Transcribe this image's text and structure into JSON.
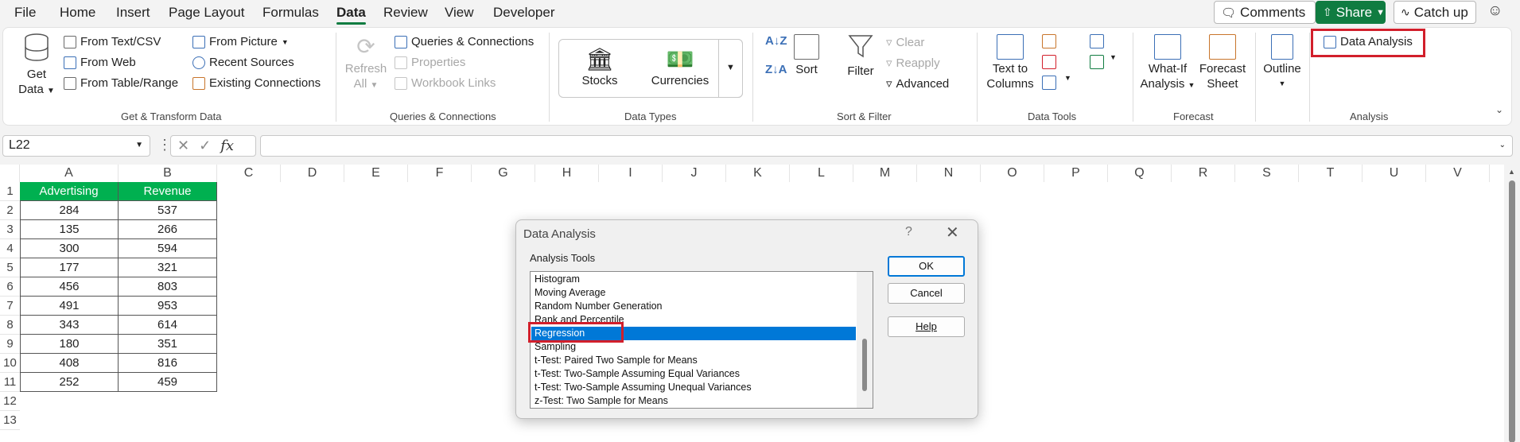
{
  "menu": {
    "tabs": [
      {
        "label": "File"
      },
      {
        "label": "Home"
      },
      {
        "label": "Insert"
      },
      {
        "label": "Page Layout"
      },
      {
        "label": "Formulas"
      },
      {
        "label": "Data"
      },
      {
        "label": "Review"
      },
      {
        "label": "View"
      },
      {
        "label": "Developer"
      }
    ],
    "active_tab": "Data",
    "comments_label": "Comments",
    "share_label": "Share",
    "catchup_label": "Catch up"
  },
  "ribbon": {
    "get_data": {
      "line1": "Get",
      "line2": "Data"
    },
    "from_text_csv": "From Text/CSV",
    "from_web": "From Web",
    "from_table_range": "From Table/Range",
    "from_picture": "From Picture",
    "recent_sources": "Recent Sources",
    "existing_connections": "Existing Connections",
    "group_get_transform": "Get & Transform Data",
    "refresh_all": {
      "line1": "Refresh",
      "line2": "All"
    },
    "queries_connections": "Queries & Connections",
    "properties": "Properties",
    "workbook_links": "Workbook Links",
    "group_queries": "Queries & Connections",
    "stocks": "Stocks",
    "currencies": "Currencies",
    "group_data_types": "Data Types",
    "sort": "Sort",
    "filter": "Filter",
    "clear": "Clear",
    "reapply": "Reapply",
    "advanced": "Advanced",
    "group_sort_filter": "Sort & Filter",
    "text_to_columns": {
      "line1": "Text to",
      "line2": "Columns"
    },
    "group_data_tools": "Data Tools",
    "what_if": {
      "line1": "What-If",
      "line2": "Analysis"
    },
    "forecast_sheet": {
      "line1": "Forecast",
      "line2": "Sheet"
    },
    "group_forecast": "Forecast",
    "outline": "Outline",
    "data_analysis": "Data Analysis",
    "group_analysis": "Analysis"
  },
  "formula_bar": {
    "name_box": "L22",
    "fx": "fx",
    "formula": ""
  },
  "sheet": {
    "columns": [
      "A",
      "B",
      "C",
      "D",
      "E",
      "F",
      "G",
      "H",
      "I",
      "J",
      "K",
      "L",
      "M",
      "N",
      "O",
      "P",
      "Q",
      "R",
      "S",
      "T",
      "U",
      "V"
    ],
    "rows": [
      "1",
      "2",
      "3",
      "4",
      "5",
      "6",
      "7",
      "8",
      "9",
      "10",
      "11",
      "12",
      "13"
    ],
    "headers": [
      "Advertising",
      "Revenue"
    ],
    "data": [
      [
        "284",
        "537"
      ],
      [
        "135",
        "266"
      ],
      [
        "300",
        "594"
      ],
      [
        "177",
        "321"
      ],
      [
        "456",
        "803"
      ],
      [
        "491",
        "953"
      ],
      [
        "343",
        "614"
      ],
      [
        "180",
        "351"
      ],
      [
        "408",
        "816"
      ],
      [
        "252",
        "459"
      ]
    ],
    "header_color": "#00B050"
  },
  "dialog": {
    "title": "Data Analysis",
    "help_symbol": "?",
    "label": "Analysis Tools",
    "items": [
      "Histogram",
      "Moving Average",
      "Random Number Generation",
      "Rank and Percentile",
      "Regression",
      "Sampling",
      "t-Test: Paired Two Sample for Means",
      "t-Test: Two-Sample Assuming Equal Variances",
      "t-Test: Two-Sample Assuming Unequal Variances",
      "z-Test: Two Sample for Means"
    ],
    "selected": "Regression",
    "ok_label": "OK",
    "cancel_label": "Cancel",
    "help_label": "Help"
  },
  "highlight_color": "#D21F2B"
}
